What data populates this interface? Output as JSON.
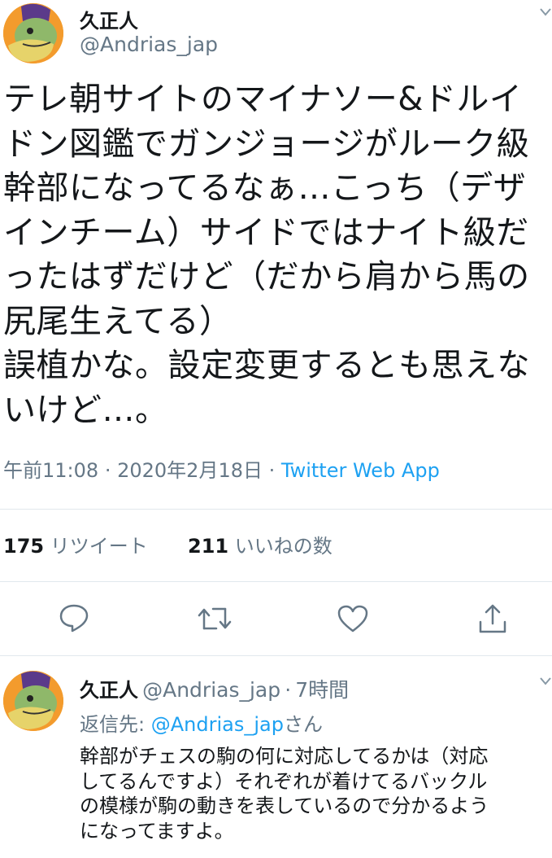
{
  "tweet": {
    "author_name": "久正人",
    "author_handle": "@Andrias_jap",
    "text": "テレ朝サイトのマイナソー&ドルイ\nドン図鑑でガンジョージがルーク級\n幹部になってるなぁ…こっち（デザ\nインチーム）サイドではナイト級だ\nったはずだけど（だから肩から馬の\n尻尾生えてる）\n誤植かな。設定変更するとも思えな\nいけど…。",
    "time": "午前11:08",
    "sep1": "·",
    "date": "2020年2月18日",
    "sep2": "·",
    "app": "Twitter Web App",
    "retweet_count": "175",
    "retweet_label": "リツイート",
    "like_count": "211",
    "like_label": "いいねの数"
  },
  "actions": {
    "icons": [
      "reply-icon",
      "retweet-icon",
      "like-icon",
      "share-icon"
    ]
  },
  "reply": {
    "author_name": "久正人",
    "author_handle": "@Andrias_jap",
    "sep": "·",
    "time_ago": "7時間",
    "reply_to_prefix": "返信先:",
    "reply_to_handle": "@Andrias_jap",
    "reply_to_suffix": "さん",
    "text": "幹部がチェスの駒の何に対応してるかは（対応\nしてるんですよ）それぞれが着けてるバックル\nの模様が駒の動きを表しているので分かるよう\nになってますよ。"
  },
  "colors": {
    "link": "#1da1f2",
    "secondary_text": "#657786",
    "divider": "#e1e8ed"
  }
}
